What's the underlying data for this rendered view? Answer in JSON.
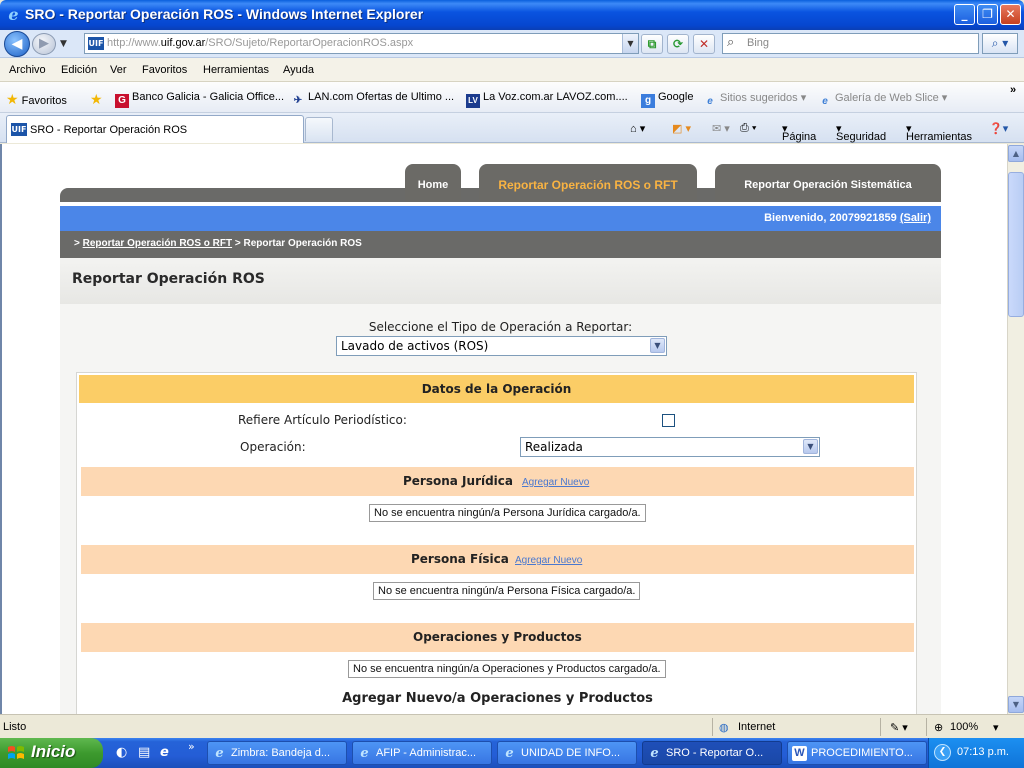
{
  "window": {
    "title": "SRO - Reportar Operación ROS - Windows Internet Explorer",
    "buttons": {
      "minimize": "_",
      "maximize": "❐",
      "close": "✕"
    }
  },
  "address": {
    "url_prefix": "http://www.",
    "url_host": "uif.gov.ar",
    "url_path": "/SRO/Sujeto/ReportarOperacionROS.aspx",
    "favicon_text": "UIF",
    "search_placeholder": "Bing"
  },
  "menu": [
    "Archivo",
    "Edición",
    "Ver",
    "Favoritos",
    "Herramientas",
    "Ayuda"
  ],
  "favorites_bar": {
    "favorites_label": "Favoritos",
    "items": [
      {
        "label": "Banco Galicia - Galicia Office...",
        "icon": "galicia-icon",
        "color": "#c8102e"
      },
      {
        "label": "LAN.com Ofertas de Ultimo ...",
        "icon": "lan-icon",
        "color": "#1b3b8e"
      },
      {
        "label": "La Voz.com.ar  LAVOZ.com....",
        "icon": "lavoz-icon",
        "color": "#1b3b8e"
      },
      {
        "label": "Google",
        "icon": "google-icon",
        "color": "#3b7ddd"
      },
      {
        "label": "Sitios sugeridos",
        "icon": "ie-page-icon",
        "dim": true
      },
      {
        "label": "Galería de Web Slice",
        "icon": "ie-page-icon",
        "dim": true
      }
    ],
    "overflow": "»"
  },
  "tabs": {
    "active_tab": "SRO - Reportar Operación ROS",
    "command_bar": [
      "Página",
      "Seguridad",
      "Herramientas"
    ]
  },
  "site": {
    "nav_tabs": [
      "Home",
      "Reportar Operación ROS o RFT",
      "Reportar Operación Sistemática"
    ],
    "welcome_prefix": "Bienvenido, 20079921859 ",
    "logout_link": "(Salir)",
    "breadcrumb": {
      "prefix": "> ",
      "link": "Reportar Operación ROS o RFT",
      "current": " > Reportar Operación ROS"
    },
    "page_title": "Reportar Operación ROS",
    "op_type_label": "Seleccione el Tipo de Operación a Reportar:",
    "op_type_value": "Lavado de activos (ROS)",
    "datos_header": "Datos de la Operación",
    "refiere_label": "Refiere Artículo Periodístico:",
    "operacion_label": "Operación:",
    "operacion_value": "Realizada",
    "persona_juridica": {
      "title": "Persona Jurídica",
      "link": "Agregar Nuevo",
      "empty": "No se encuentra ningún/a Persona Jurídica cargado/a."
    },
    "persona_fisica": {
      "title": "Persona Física",
      "link": "Agregar Nuevo",
      "empty": "No se encuentra ningún/a Persona Física cargado/a."
    },
    "operaciones": {
      "title": "Operaciones y Productos",
      "empty": "No se encuentra ningún/a Operaciones y Productos cargado/a."
    },
    "agregar_nuevo_title": "Agregar Nuevo/a Operaciones y Productos"
  },
  "statusbar": {
    "status": "Listo",
    "zone": "Internet",
    "zoom": "100%"
  },
  "taskbar": {
    "start": "Inicio",
    "items": [
      {
        "label": "Zimbra: Bandeja d...",
        "active": false
      },
      {
        "label": "AFIP - Administrac...",
        "active": false
      },
      {
        "label": "UNIDAD DE INFO...",
        "active": false
      },
      {
        "label": "SRO - Reportar O...",
        "active": true
      },
      {
        "label": "PROCEDIMIENTO...",
        "active": false,
        "word": true
      }
    ],
    "clock": "07:13 p.m."
  }
}
